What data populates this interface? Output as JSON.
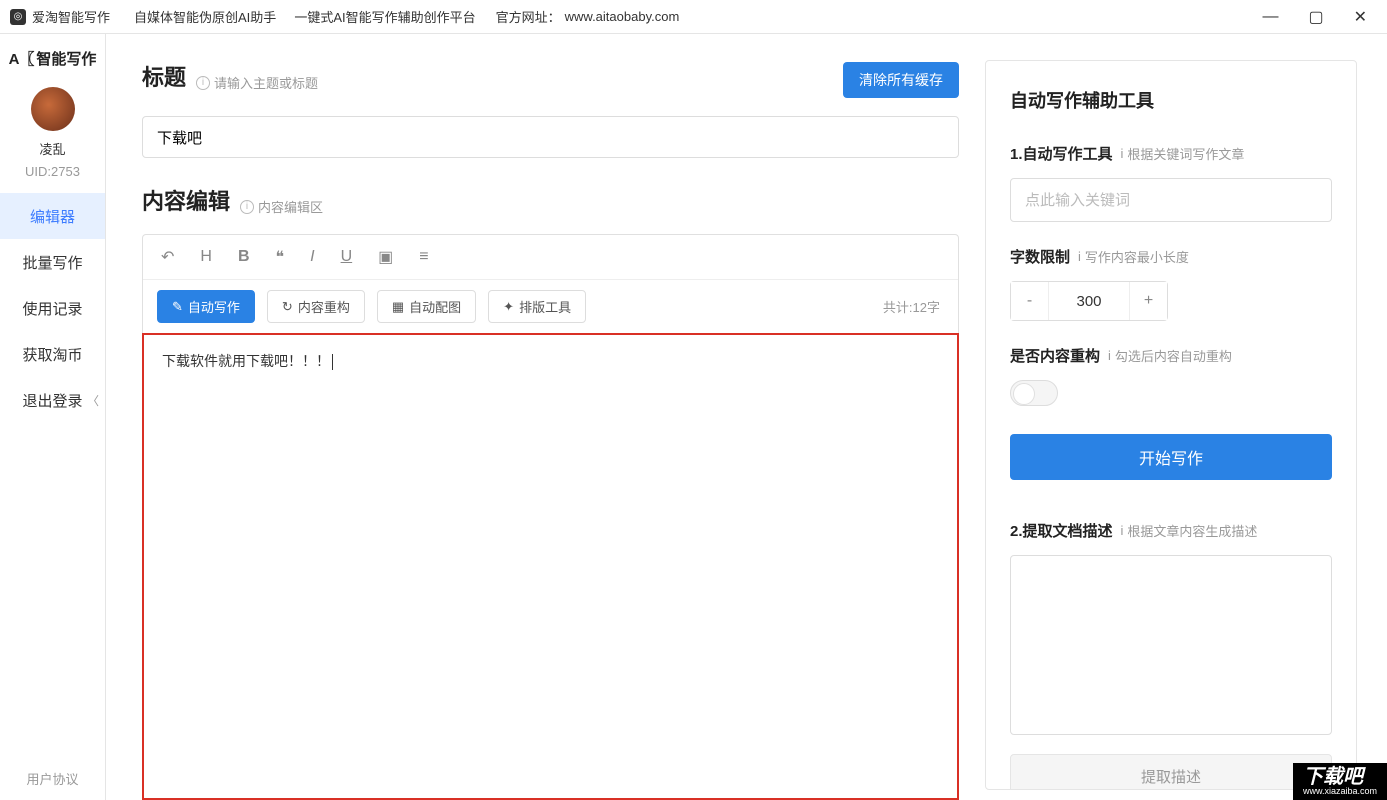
{
  "titlebar": {
    "app_name": "爱淘智能写作",
    "tagline1": "自媒体智能伪原创AI助手",
    "tagline2": "一键式AI智能写作辅助创作平台",
    "site_label": "官方网址：",
    "site_url": "www.aitaobaby.com"
  },
  "sidebar": {
    "logo_text": "智能写作",
    "username": "凌乱",
    "uid": "UID:2753",
    "nav": [
      "编辑器",
      "批量写作",
      "使用记录",
      "获取淘币",
      "退出登录"
    ],
    "footer_link": "用户协议"
  },
  "editor": {
    "title_label": "标题",
    "title_hint": "请输入主题或标题",
    "clear_cache_btn": "清除所有缓存",
    "title_value": "下载吧",
    "content_label": "内容编辑",
    "content_hint": "内容编辑区",
    "action_auto_write": "自动写作",
    "action_rebuild": "内容重构",
    "action_auto_image": "自动配图",
    "action_layout": "排版工具",
    "char_count": "共计:12字",
    "content_text": "下载软件就用下载吧！！！"
  },
  "side": {
    "panel_title": "自动写作辅助工具",
    "sec1_title": "1.自动写作工具",
    "sec1_hint": "根据关键词写作文章",
    "keyword_placeholder": "点此输入关键词",
    "word_limit_label": "字数限制",
    "word_limit_hint": "写作内容最小长度",
    "word_limit_value": "300",
    "rebuild_label": "是否内容重构",
    "rebuild_hint": "勾选后内容自动重构",
    "start_btn": "开始写作",
    "sec2_title": "2.提取文档描述",
    "sec2_hint": "根据文章内容生成描述",
    "extract_btn": "提取描述"
  },
  "watermark": {
    "main": "下载吧",
    "sub": "www.xiazaiba.com"
  }
}
